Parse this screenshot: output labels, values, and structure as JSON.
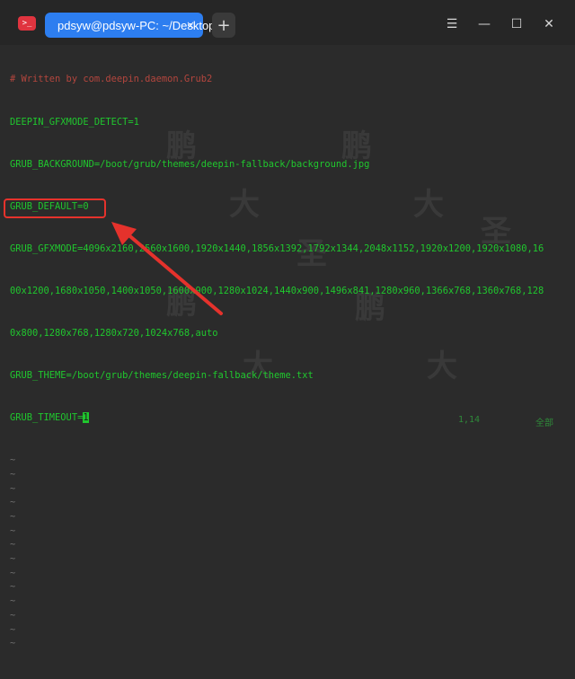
{
  "app": {
    "icon_glyph": ">_",
    "tab_title": "pdsyw@pdsyw-PC: ~/Desktop",
    "tab_close": "×",
    "new_tab": "+",
    "window_buttons": {
      "menu": "☰",
      "minimize": "—",
      "maximize": "☐",
      "close": "✕"
    }
  },
  "terminal": {
    "comment": "# Written by com.deepin.daemon.Grub2",
    "lines": [
      "DEEPIN_GFXMODE_DETECT=1",
      "GRUB_BACKGROUND=/boot/grub/themes/deepin-fallback/background.jpg",
      "GRUB_DEFAULT=0",
      "GRUB_GFXMODE=4096x2160,2560x1600,1920x1440,1856x1392,1792x1344,2048x1152,1920x1200,1920x1080,16",
      "00x1200,1680x1050,1400x1050,1600x900,1280x1024,1440x900,1496x841,1280x960,1366x768,1360x768,128",
      "0x800,1280x768,1280x720,1024x768,auto",
      "GRUB_THEME=/boot/grub/themes/deepin-fallback/theme.txt"
    ],
    "timeout_prefix": "GRUB_TIMEOUT=",
    "timeout_value": "1",
    "tilde": "~",
    "tilde_count": 14
  },
  "watermark": [
    "鹏",
    "大",
    "圣"
  ],
  "status": {
    "left": "1,14",
    "right": "全部"
  },
  "colors": {
    "text": "#20c72e",
    "comment": "#b4463e",
    "annotation": "#e5322c",
    "tab": "#2d7ef0"
  }
}
